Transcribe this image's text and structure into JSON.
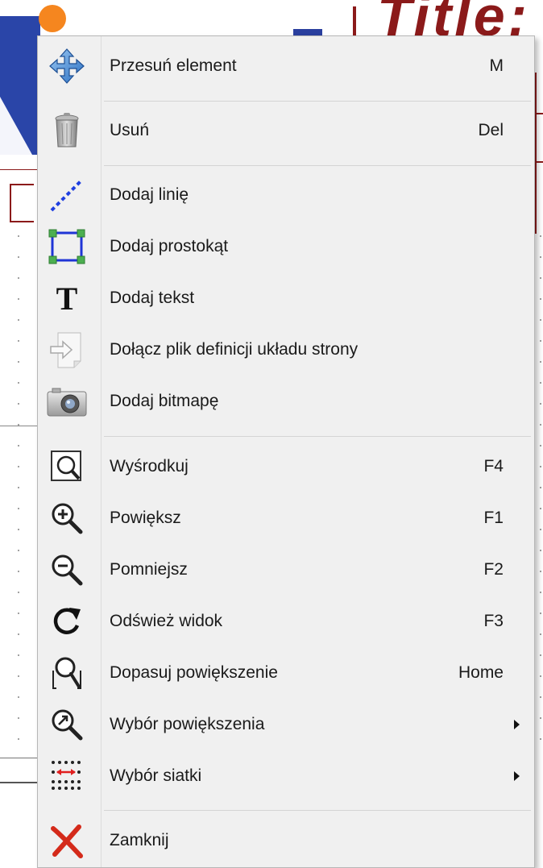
{
  "background": {
    "title_fragment": "Title:"
  },
  "menu": {
    "items": [
      {
        "id": "move",
        "label": "Przesuń element",
        "shortcut": "M",
        "icon": "move-arrows-icon"
      },
      {
        "id": "delete",
        "label": "Usuń",
        "shortcut": "Del",
        "icon": "trash-can-icon"
      },
      {
        "id": "add-line",
        "label": "Dodaj linię",
        "shortcut": "",
        "icon": "dashed-line-icon"
      },
      {
        "id": "add-rect",
        "label": "Dodaj prostokąt",
        "shortcut": "",
        "icon": "rectangle-icon"
      },
      {
        "id": "add-text",
        "label": "Dodaj tekst",
        "shortcut": "",
        "icon": "text-t-icon"
      },
      {
        "id": "append-file",
        "label": "Dołącz plik definicji układu strony",
        "shortcut": "",
        "icon": "import-file-icon"
      },
      {
        "id": "add-bitmap",
        "label": "Dodaj bitmapę",
        "shortcut": "",
        "icon": "camera-icon"
      },
      {
        "id": "center",
        "label": "Wyśrodkuj",
        "shortcut": "F4",
        "icon": "zoom-center-icon"
      },
      {
        "id": "zoom-in",
        "label": "Powiększ",
        "shortcut": "F1",
        "icon": "zoom-in-icon"
      },
      {
        "id": "zoom-out",
        "label": "Pomniejsz",
        "shortcut": "F2",
        "icon": "zoom-out-icon"
      },
      {
        "id": "refresh",
        "label": "Odśwież widok",
        "shortcut": "F3",
        "icon": "refresh-icon"
      },
      {
        "id": "zoom-fit",
        "label": "Dopasuj powiększenie",
        "shortcut": "Home",
        "icon": "zoom-fit-icon"
      },
      {
        "id": "zoom-select",
        "label": "Wybór powiększenia",
        "shortcut": "",
        "icon": "zoom-select-icon",
        "submenu": true
      },
      {
        "id": "grid-select",
        "label": "Wybór siatki",
        "shortcut": "",
        "icon": "grid-icon",
        "submenu": true
      },
      {
        "id": "close",
        "label": "Zamknij",
        "shortcut": "",
        "icon": "close-x-icon"
      }
    ]
  }
}
